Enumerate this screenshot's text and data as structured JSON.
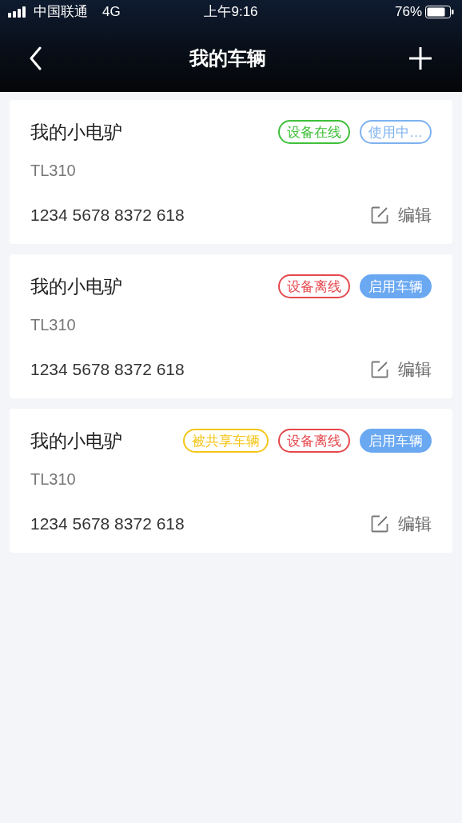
{
  "status_bar": {
    "carrier": "中国联通",
    "network": "4G",
    "time": "上午9:16",
    "battery": "76%"
  },
  "nav": {
    "title": "我的车辆"
  },
  "vehicles": [
    {
      "name": "我的小电驴",
      "model": "TL310",
      "serial": "1234 5678 8372 618",
      "edit": "编辑",
      "tags": [
        {
          "label": "设备在线",
          "kind": "outline",
          "color": "#3fbf3a"
        },
        {
          "label": "使用中…",
          "kind": "outline",
          "color": "#7fb2f0"
        }
      ]
    },
    {
      "name": "我的小电驴",
      "model": "TL310",
      "serial": "1234 5678 8372 618",
      "edit": "编辑",
      "tags": [
        {
          "label": "设备离线",
          "kind": "outline",
          "color": "#e5484d"
        },
        {
          "label": "启用车辆",
          "kind": "filled",
          "color": "#6aa8f2"
        }
      ]
    },
    {
      "name": "我的小电驴",
      "model": "TL310",
      "serial": "1234 5678 8372 618",
      "edit": "编辑",
      "tags": [
        {
          "label": "被共享车辆",
          "kind": "outline",
          "color": "#f5c518"
        },
        {
          "label": "设备离线",
          "kind": "outline",
          "color": "#e5484d"
        },
        {
          "label": "启用车辆",
          "kind": "filled",
          "color": "#6aa8f2"
        }
      ]
    }
  ]
}
